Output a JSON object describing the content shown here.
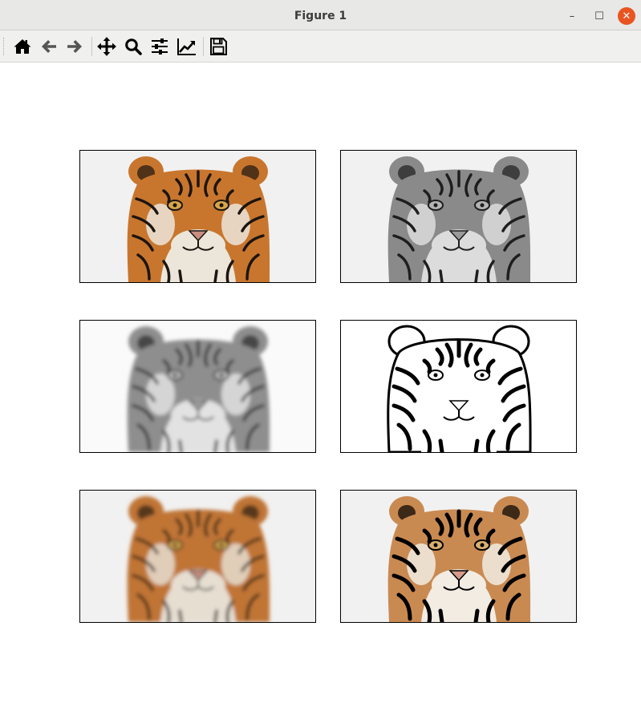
{
  "window": {
    "title": "Figure 1",
    "minimize_glyph": "–",
    "maximize_glyph": "☐",
    "close_glyph": "✕"
  },
  "toolbar": {
    "tools": [
      {
        "name": "home-icon"
      },
      {
        "name": "back-arrow-icon"
      },
      {
        "name": "forward-arrow-icon"
      },
      {
        "name": "pan-icon"
      },
      {
        "name": "zoom-icon"
      },
      {
        "name": "configure-subplots-icon"
      },
      {
        "name": "edit-axes-icon"
      },
      {
        "name": "save-icon"
      }
    ]
  },
  "figure": {
    "layout": "3x2",
    "panels": [
      {
        "name": "panel-original-color",
        "style": "color"
      },
      {
        "name": "panel-grayscale",
        "style": "gray"
      },
      {
        "name": "panel-gray-blurred",
        "style": "gray-blur"
      },
      {
        "name": "panel-edge-mask",
        "style": "edges"
      },
      {
        "name": "panel-color-blurred",
        "style": "color-blur"
      },
      {
        "name": "panel-cartoon",
        "style": "cartoon"
      }
    ]
  },
  "colors": {
    "close_button": "#e95420",
    "titlebar": "#e8e8e7",
    "toolbar": "#f0f0ef",
    "axes_background": "#f1f1f1",
    "tiger_orange": "#c8762e"
  }
}
